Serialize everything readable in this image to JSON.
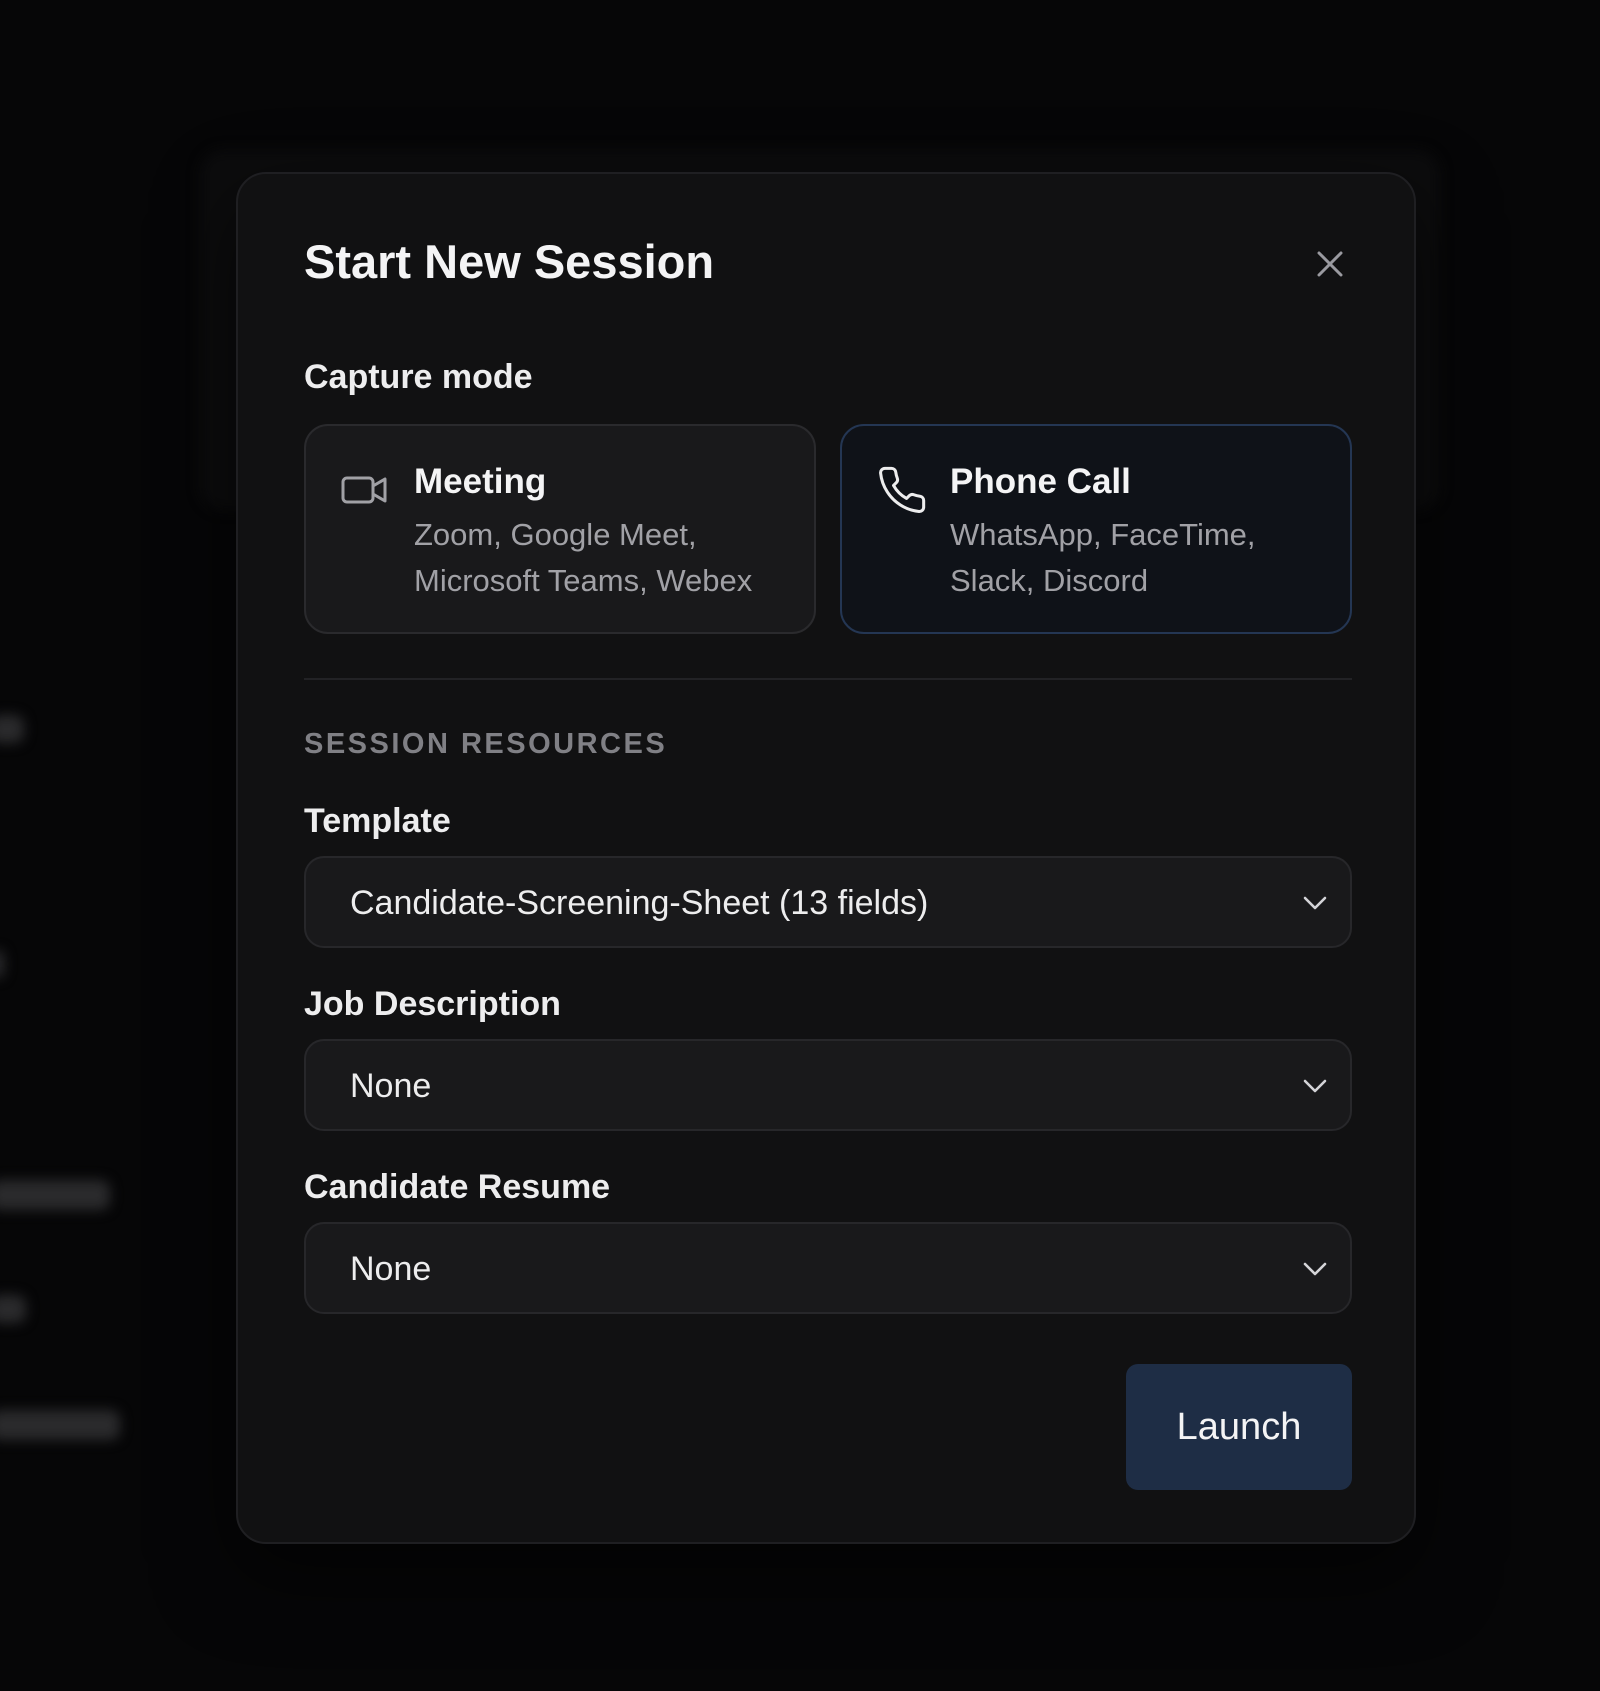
{
  "dialog": {
    "title": "Start New Session"
  },
  "capture_mode": {
    "label": "Capture mode",
    "options": [
      {
        "title": "Meeting",
        "description": "Zoom, Google Meet, Microsoft Teams, Webex",
        "icon": "video-camera-icon",
        "selected": false
      },
      {
        "title": "Phone Call",
        "description": "WhatsApp, FaceTime, Slack, Discord",
        "icon": "phone-icon",
        "selected": true
      }
    ]
  },
  "resources": {
    "section_label": "SESSION RESOURCES",
    "template": {
      "label": "Template",
      "value": "Candidate-Screening-Sheet (13 fields)"
    },
    "job_description": {
      "label": "Job Description",
      "value": "None"
    },
    "candidate_resume": {
      "label": "Candidate Resume",
      "value": "None"
    }
  },
  "actions": {
    "launch_label": "Launch"
  },
  "colors": {
    "background": "#060607",
    "modal": "#111112",
    "selected_border": "#243653",
    "primary_button": "#1e2d45"
  }
}
